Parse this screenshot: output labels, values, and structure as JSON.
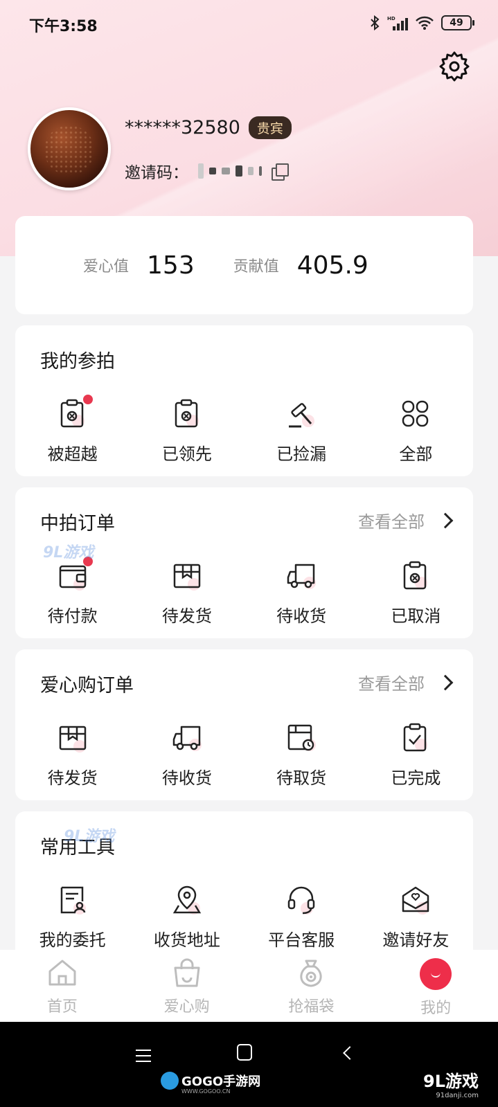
{
  "status_bar": {
    "time": "下午3:58",
    "battery": "49",
    "network": "HD"
  },
  "profile": {
    "username": "******32580",
    "badge": "贵宾",
    "invite_label": "邀请码："
  },
  "stats": [
    {
      "label": "爱心值",
      "value": "153"
    },
    {
      "label": "贡献值",
      "value": "405.9"
    }
  ],
  "auctions": {
    "title": "我的参拍",
    "items": [
      {
        "label": "被超越",
        "icon": "clipboard-x-icon",
        "dot": true
      },
      {
        "label": "已领先",
        "icon": "clipboard-x-icon",
        "dot": false
      },
      {
        "label": "已捡漏",
        "icon": "gavel-icon",
        "dot": false
      },
      {
        "label": "全部",
        "icon": "grid-icon",
        "dot": false
      }
    ]
  },
  "auction_orders": {
    "title": "中拍订单",
    "view_all": "查看全部",
    "items": [
      {
        "label": "待付款",
        "icon": "wallet-icon",
        "dot": true
      },
      {
        "label": "待发货",
        "icon": "package-icon",
        "dot": false
      },
      {
        "label": "待收货",
        "icon": "truck-icon",
        "dot": false
      },
      {
        "label": "已取消",
        "icon": "clipboard-x-icon",
        "dot": false
      }
    ]
  },
  "love_orders": {
    "title": "爱心购订单",
    "view_all": "查看全部",
    "items": [
      {
        "label": "待发货",
        "icon": "package-icon"
      },
      {
        "label": "待收货",
        "icon": "truck-icon"
      },
      {
        "label": "待取货",
        "icon": "pickup-icon"
      },
      {
        "label": "已完成",
        "icon": "clipboard-check-icon"
      }
    ]
  },
  "tools": {
    "title": "常用工具",
    "items": [
      {
        "label": "我的委托",
        "icon": "document-user-icon"
      },
      {
        "label": "收货地址",
        "icon": "map-pin-icon"
      },
      {
        "label": "平台客服",
        "icon": "headset-icon"
      },
      {
        "label": "邀请好友",
        "icon": "envelope-heart-icon"
      }
    ]
  },
  "tabbar": [
    {
      "label": "首页",
      "icon": "home-icon"
    },
    {
      "label": "爱心购",
      "icon": "shopping-bag-icon"
    },
    {
      "label": "抢福袋",
      "icon": "lucky-bag-icon"
    },
    {
      "label": "我的",
      "icon": "profile-face-icon",
      "active": true
    }
  ],
  "watermarks": {
    "left": "GOGO手游网",
    "left_sub": "WWW.GOGOO.CN",
    "right": "9L游戏",
    "right_sub": "91danji.com",
    "overlay": "9L游戏"
  },
  "colors": {
    "accent": "#ee2e4a",
    "badge_bg": "#3a2a22",
    "badge_text": "#f5d7a8",
    "hero_pink": "#fbdde3"
  }
}
